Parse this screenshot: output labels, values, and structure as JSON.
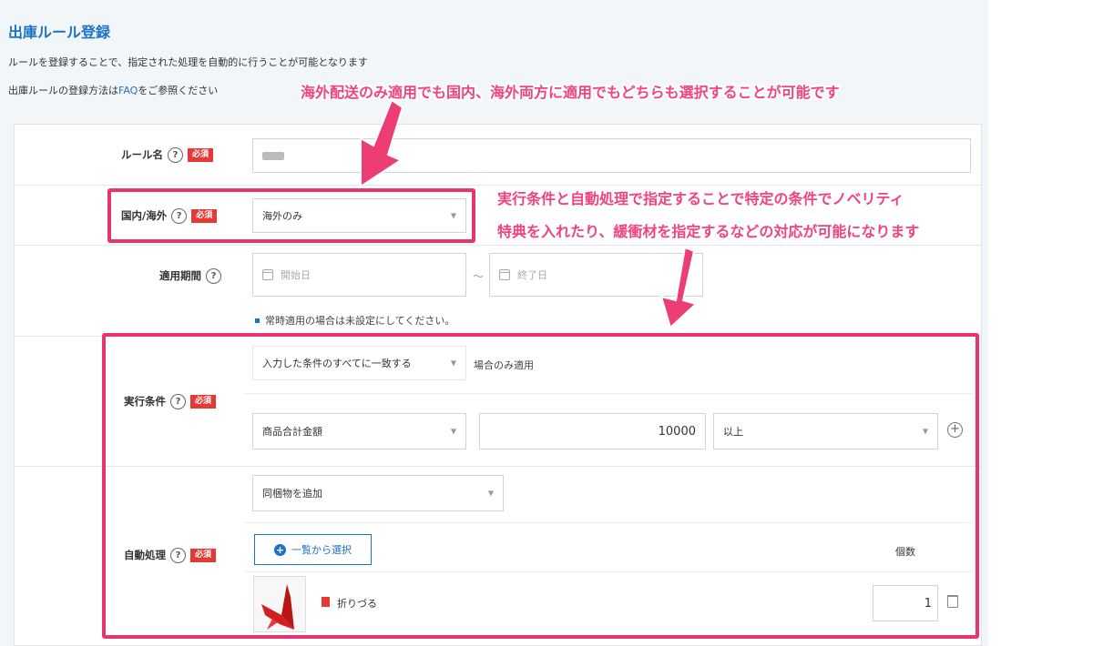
{
  "page": {
    "title": "出庫ルール登録",
    "description": "ルールを登録することで、指定された処理を自動的に行うことが可能となります",
    "faq_prefix": "出庫ルールの登録方法は",
    "faq_link": "FAQ",
    "faq_suffix": "をご参照ください"
  },
  "form": {
    "rule_name": {
      "label": "ルール名",
      "required": "必須"
    },
    "region": {
      "label": "国内/海外",
      "required": "必須",
      "value": "海外のみ"
    },
    "period": {
      "label": "適用期間",
      "start_placeholder": "開始日",
      "end_placeholder": "終了日",
      "separator": "〜",
      "note": "常時適用の場合は未設定にしてください。"
    },
    "condition": {
      "label": "実行条件",
      "required": "必須",
      "match_value": "入力した条件のすべてに一致する",
      "match_suffix": "場合のみ適用",
      "field": "商品合計金額",
      "amount": "10000",
      "operator": "以上"
    },
    "action": {
      "label": "自動処理",
      "required": "必須",
      "type_value": "同梱物を追加",
      "select_button": "一覧から選択",
      "qty_header": "個数",
      "item_name": "折りづる",
      "item_qty": "1"
    }
  },
  "annotations": {
    "top": "海外配送のみ適用でも国内、海外両方に適用でもどちらも選択することが可能です",
    "right_line1": "実行条件と自動処理で指定することで特定の条件でノベリティ",
    "right_line2": "特典を入れたり、緩衝材を指定するなどの対応が可能になります"
  },
  "colors": {
    "accent": "#1a73c8",
    "required": "#e53935",
    "highlight": "#e8356b",
    "annotation": "#f0437f"
  }
}
